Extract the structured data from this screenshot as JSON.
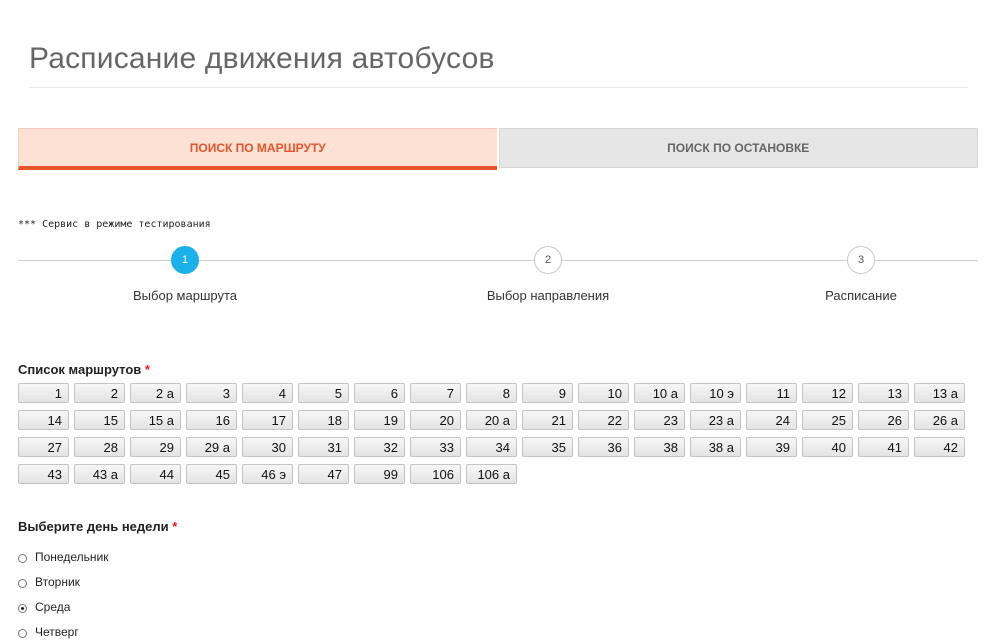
{
  "page": {
    "title": "Расписание движения автобусов"
  },
  "tabs": [
    {
      "label": "ПОИСК ПО МАРШРУТУ",
      "active": true
    },
    {
      "label": "ПОИСК ПО ОСТАНОВКЕ",
      "active": false
    }
  ],
  "note": "*** Сервис в режиме тестирования",
  "steps": [
    {
      "number": "1",
      "label": "Выбор маршрута",
      "active": true
    },
    {
      "number": "2",
      "label": "Выбор направления",
      "active": false
    },
    {
      "number": "3",
      "label": "Расписание",
      "active": false
    }
  ],
  "routes_label": "Список маршрутов",
  "required_mark": "*",
  "routes": [
    "1",
    "2",
    "2 а",
    "3",
    "4",
    "5",
    "6",
    "7",
    "8",
    "9",
    "10",
    "10 а",
    "10 э",
    "11",
    "12",
    "13",
    "13 а",
    "14",
    "15",
    "15 а",
    "16",
    "17",
    "18",
    "19",
    "20",
    "20 а",
    "21",
    "22",
    "23",
    "23 а",
    "24",
    "25",
    "26",
    "26 а",
    "27",
    "28",
    "29",
    "29 а",
    "30",
    "31",
    "32",
    "33",
    "34",
    "35",
    "36",
    "38",
    "38 а",
    "39",
    "40",
    "41",
    "42",
    "43",
    "43 а",
    "44",
    "45",
    "46 э",
    "47",
    "99",
    "106",
    "106 а"
  ],
  "day_label": "Выберите день недели",
  "days": [
    {
      "label": "Понедельник",
      "checked": false
    },
    {
      "label": "Вторник",
      "checked": false
    },
    {
      "label": "Среда",
      "checked": true
    },
    {
      "label": "Четверг",
      "checked": false
    }
  ]
}
